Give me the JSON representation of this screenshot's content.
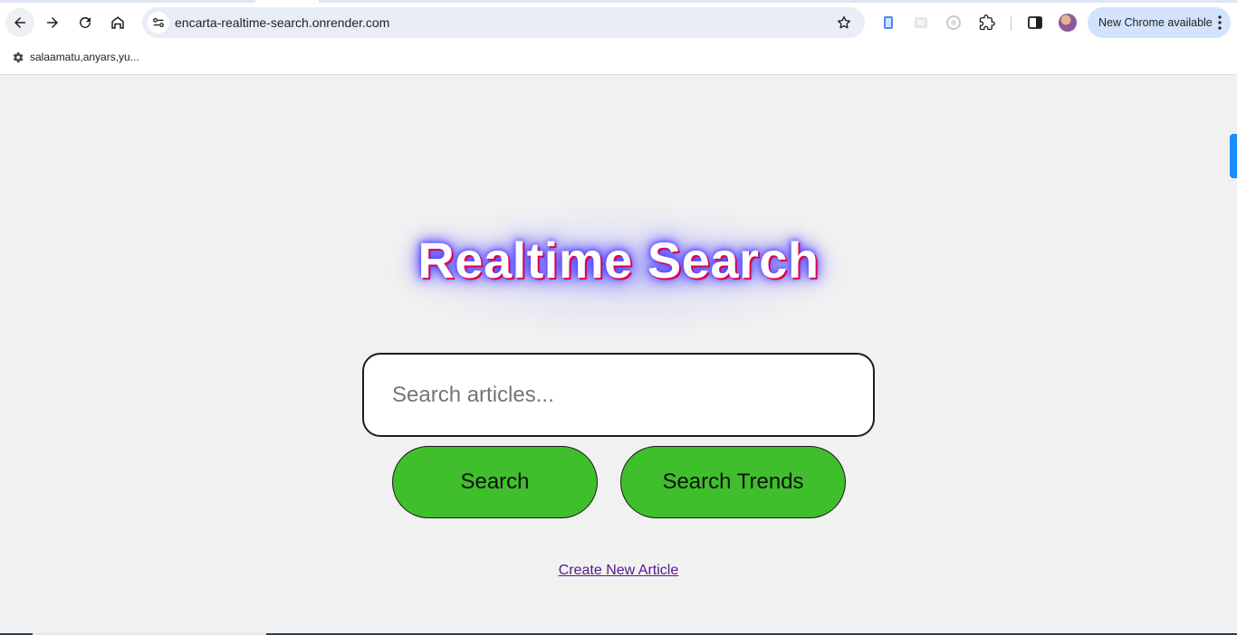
{
  "browser": {
    "url": "encarta-realtime-search.onrender.com",
    "update_button": "New Chrome available",
    "bookmarks": [
      {
        "label": "salaamatu,anyars,yu..."
      }
    ]
  },
  "page": {
    "title": "Realtime Search",
    "search": {
      "placeholder": "Search articles...",
      "value": ""
    },
    "buttons": {
      "search": "Search",
      "trends": "Search Trends"
    },
    "create_link": "Create New Article"
  },
  "colors": {
    "button_green": "#3fbf2b",
    "title_glow": "#4433ff",
    "title_shadow": "#e0004d",
    "link_visited": "#551a8b",
    "page_bg": "#f1f1f1"
  },
  "icons": [
    "back-arrow-icon",
    "forward-arrow-icon",
    "reload-icon",
    "home-icon",
    "site-info-icon",
    "star-icon",
    "extension-icon",
    "puzzle-icon",
    "side-panel-icon",
    "more-vert-icon",
    "gear-icon"
  ]
}
